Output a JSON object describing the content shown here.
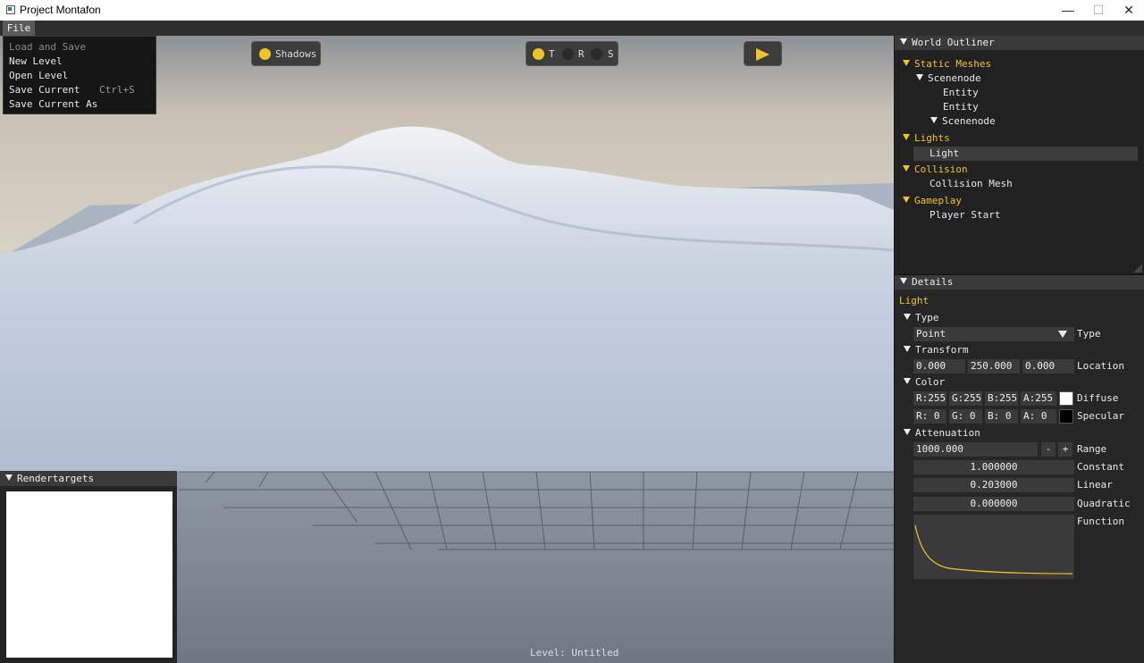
{
  "window": {
    "title": "Project Montafon",
    "minimize": "—",
    "maximize": "☐",
    "close": "✕"
  },
  "menu": {
    "file": "File",
    "items": [
      {
        "label": "Load and Save",
        "shortcut": "",
        "disabled": true
      },
      {
        "label": "New Level",
        "shortcut": ""
      },
      {
        "label": "Open Level",
        "shortcut": ""
      },
      {
        "label": "Save Current",
        "shortcut": "Ctrl+S"
      },
      {
        "label": "Save Current As",
        "shortcut": ""
      }
    ]
  },
  "viewport": {
    "shadows": "Shadows",
    "t": "T",
    "r": "R",
    "s": "S",
    "status": "Level: Untitled"
  },
  "rendertargets": {
    "title": "Rendertargets"
  },
  "outliner": {
    "title": "World Outliner",
    "static_meshes": "Static Meshes",
    "scenenode": "Scenenode",
    "entity1": "Entity",
    "entity2": "Entity",
    "scenenode2": "Scenenode",
    "lights": "Lights",
    "light": "Light",
    "collision": "Collision",
    "collision_mesh": "Collision Mesh",
    "gameplay": "Gameplay",
    "player_start": "Player Start"
  },
  "details": {
    "title": "Details",
    "selected": "Light",
    "type_header": "Type",
    "type_value": "Point",
    "type_label": "Type",
    "transform_header": "Transform",
    "loc_x": "0.000",
    "loc_y": "250.000",
    "loc_z": "0.000",
    "location_label": "Location",
    "color_header": "Color",
    "diffuse": {
      "r": "R:255",
      "g": "G:255",
      "b": "B:255",
      "a": "A:255",
      "label": "Diffuse"
    },
    "specular": {
      "r": "R:  0",
      "g": "G:  0",
      "b": "B:  0",
      "a": "A:  0",
      "label": "Specular"
    },
    "attenuation_header": "Attenuation",
    "range_value": "1000.000",
    "minus": "-",
    "plus": "+",
    "range_label": "Range",
    "constant": "1.000000",
    "constant_label": "Constant",
    "linear": "0.203000",
    "linear_label": "Linear",
    "quadratic": "0.000000",
    "quadratic_label": "Quadratic",
    "function_label": "Function"
  },
  "colors": {
    "accent": "#f2c12e",
    "diffuse": "#ffffff",
    "specular": "#000000"
  }
}
